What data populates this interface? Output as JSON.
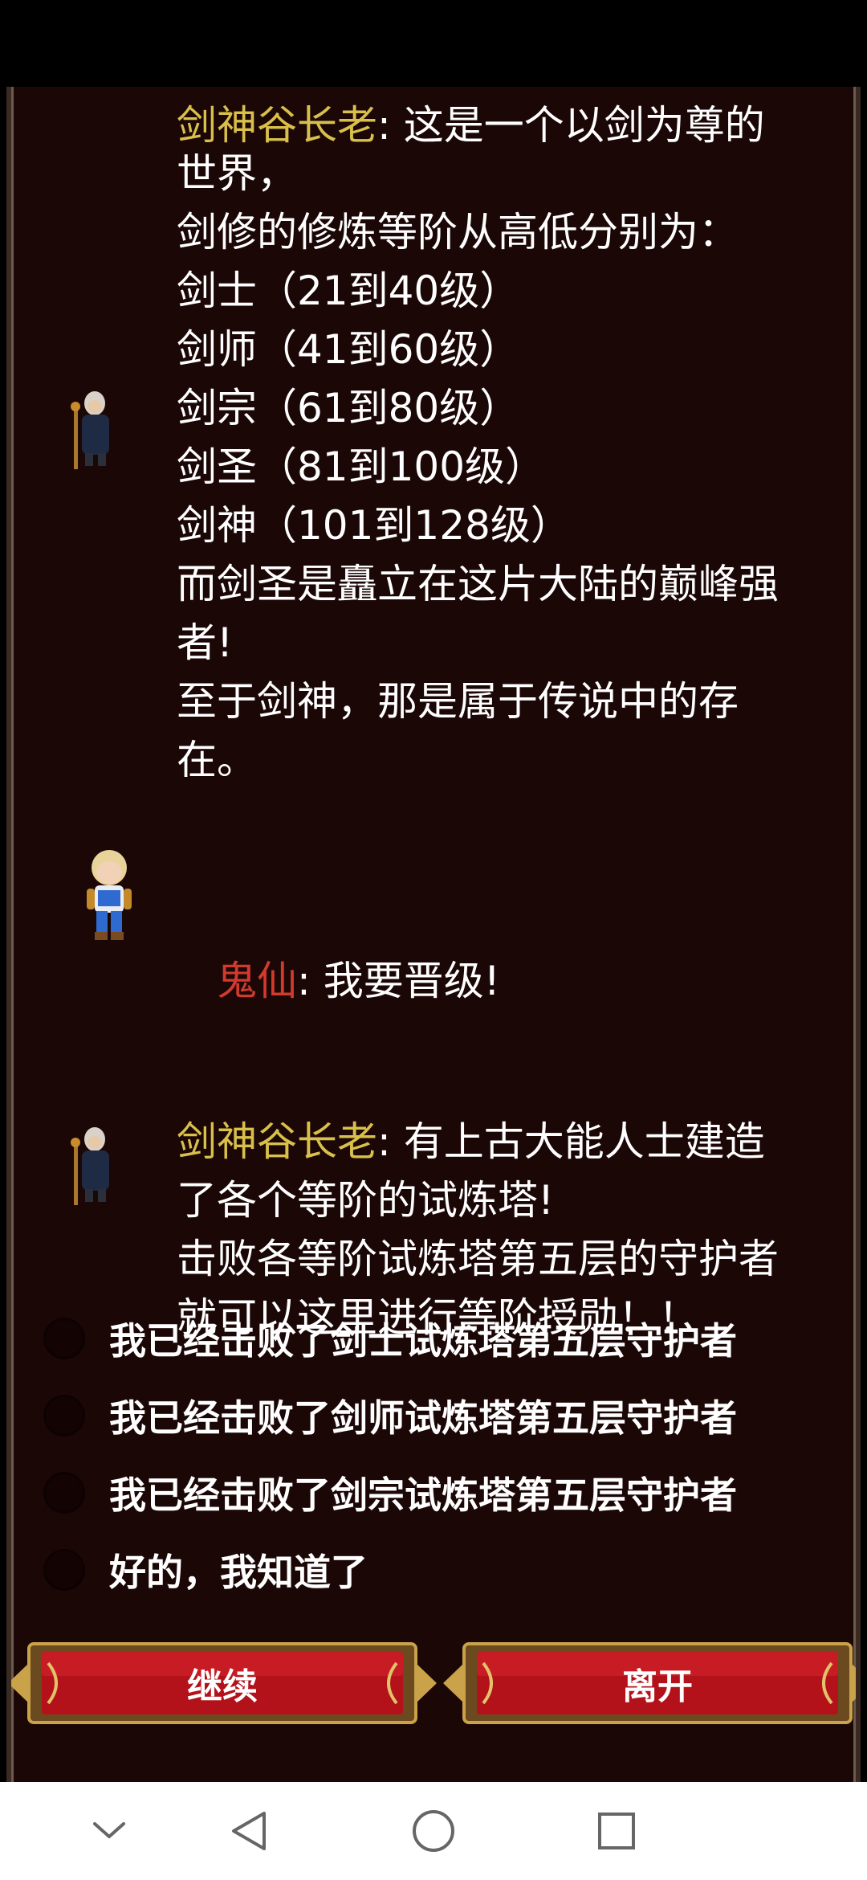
{
  "dialog": [
    {
      "speaker": "剑神谷长老",
      "text_first": ": 这是一个以剑为尊的",
      "text_rest": "世界，\n剑修的修炼等阶从高低分别为：\n剑士（21到40级）\n剑师（41到60级）\n剑宗（61到80级）\n剑圣（81到100级）\n剑神（101到128级）\n而剑圣是矗立在这片大陆的巅峰强\n者!\n至于剑神，那是属于传说中的存\n在。"
    },
    {
      "speaker": "鬼仙",
      "text": ": 我要晋级!"
    },
    {
      "speaker": "剑神谷长老",
      "text": ": 有上古大能人士建造\n了各个等阶的试炼塔!\n击败各等阶试炼塔第五层的守护者\n就可以这里进行等阶授勋！！"
    }
  ],
  "options": [
    "我已经击败了剑士试炼塔第五层守护者",
    "我已经击败了剑师试炼塔第五层守护者",
    "我已经击败了剑宗试炼塔第五层守护者",
    "好的，我知道了"
  ],
  "buttons": {
    "continue": "继续",
    "leave": "离开"
  },
  "colors": {
    "panel_bg": "#1c0707",
    "elder_name": "#d8c04a",
    "player_name": "#d23a2e",
    "button_red": "#b3121a",
    "button_gold": "#c9a24a"
  }
}
